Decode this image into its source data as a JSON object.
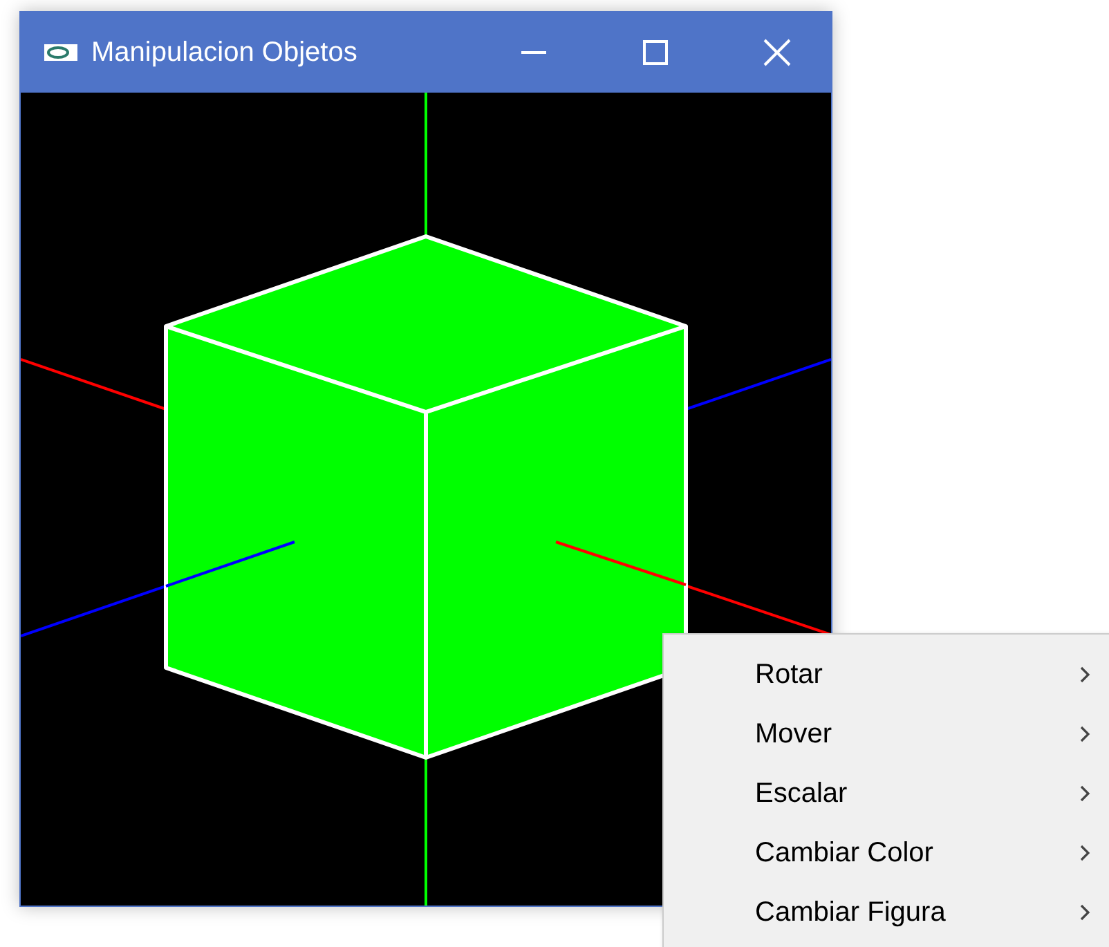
{
  "window": {
    "title": "Manipulacion Objetos"
  },
  "context_menu": {
    "items": [
      {
        "label": "Rotar",
        "has_submenu": true
      },
      {
        "label": "Mover",
        "has_submenu": true
      },
      {
        "label": "Escalar",
        "has_submenu": true
      },
      {
        "label": "Cambiar Color",
        "has_submenu": true
      },
      {
        "label": "Cambiar Figura",
        "has_submenu": true
      }
    ]
  }
}
